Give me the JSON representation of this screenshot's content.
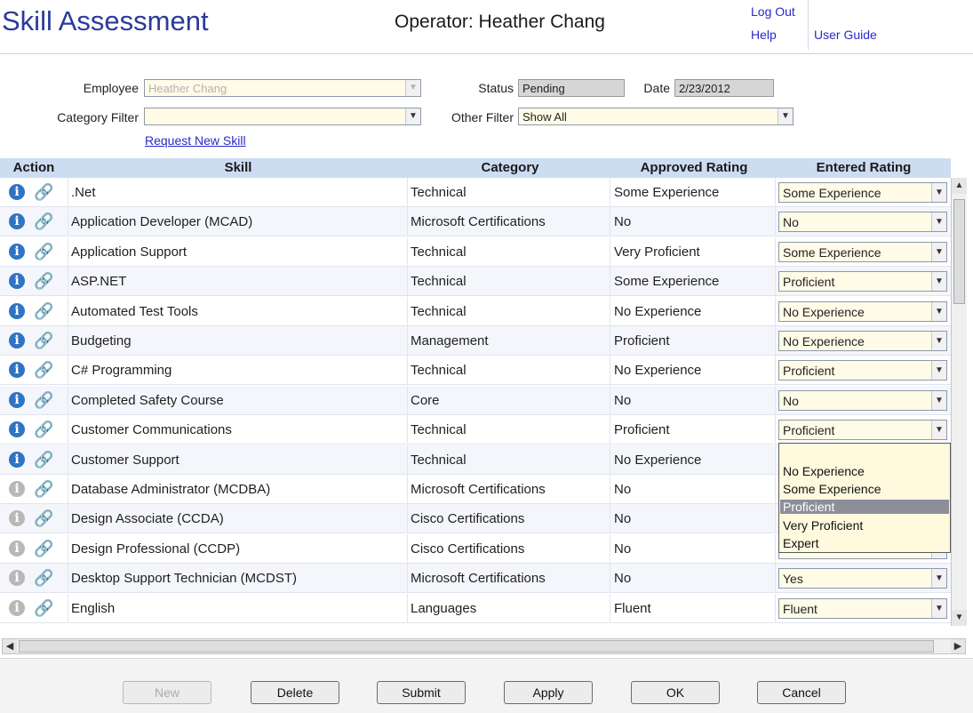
{
  "header": {
    "title": "Skill Assessment",
    "operator": "Operator: Heather Chang",
    "logout": "Log Out",
    "help": "Help",
    "user_guide": "User Guide"
  },
  "filters": {
    "employee_label": "Employee",
    "employee_value": "Heather Chang",
    "status_label": "Status",
    "status_value": "Pending",
    "date_label": "Date",
    "date_value": "2/23/2012",
    "category_label": "Category Filter",
    "category_value": "",
    "other_label": "Other Filter",
    "other_value": "Show All",
    "request_link": "Request New Skill"
  },
  "table": {
    "columns": [
      "Action",
      "Skill",
      "Category",
      "Approved Rating",
      "Entered Rating"
    ],
    "rows": [
      {
        "skill": ".Net",
        "category": "Technical",
        "approved": "Some Experience",
        "entered": "Some Experience"
      },
      {
        "skill": "Application Developer (MCAD)",
        "category": "Microsoft Certifications",
        "approved": "No",
        "entered": "No"
      },
      {
        "skill": "Application Support",
        "category": "Technical",
        "approved": "Very Proficient",
        "entered": "Some Experience"
      },
      {
        "skill": "ASP.NET",
        "category": "Technical",
        "approved": "Some Experience",
        "entered": "Proficient"
      },
      {
        "skill": "Automated Test Tools",
        "category": "Technical",
        "approved": "No Experience",
        "entered": "No Experience"
      },
      {
        "skill": "Budgeting",
        "category": "Management",
        "approved": "Proficient",
        "entered": "No Experience"
      },
      {
        "skill": "C# Programming",
        "category": "Technical",
        "approved": "No Experience",
        "entered": "Proficient"
      },
      {
        "skill": "Completed Safety Course",
        "category": "Core",
        "approved": "No",
        "entered": "No"
      },
      {
        "skill": "Customer Communications",
        "category": "Technical",
        "approved": "Proficient",
        "entered": "Proficient"
      },
      {
        "skill": "Customer Support",
        "category": "Technical",
        "approved": "No Experience",
        "entered": ""
      },
      {
        "skill": "Database Administrator (MCDBA)",
        "category": "Microsoft Certifications",
        "approved": "No",
        "entered": ""
      },
      {
        "skill": "Design Associate (CCDA)",
        "category": "Cisco Certifications",
        "approved": "No",
        "entered": ""
      },
      {
        "skill": "Design Professional (CCDP)",
        "category": "Cisco Certifications",
        "approved": "No",
        "entered": ""
      },
      {
        "skill": "Desktop Support Technician (MCDST)",
        "category": "Microsoft Certifications",
        "approved": "No",
        "entered": "Yes"
      },
      {
        "skill": "English",
        "category": "Languages",
        "approved": "Fluent",
        "entered": "Fluent"
      }
    ]
  },
  "dropdown": {
    "options": [
      "",
      "No Experience",
      "Some Experience",
      "Proficient",
      "Very Proficient",
      "Expert"
    ],
    "selected": "Proficient"
  },
  "buttons": {
    "new": "New",
    "delete": "Delete",
    "submit": "Submit",
    "apply": "Apply",
    "ok": "OK",
    "cancel": "Cancel"
  }
}
